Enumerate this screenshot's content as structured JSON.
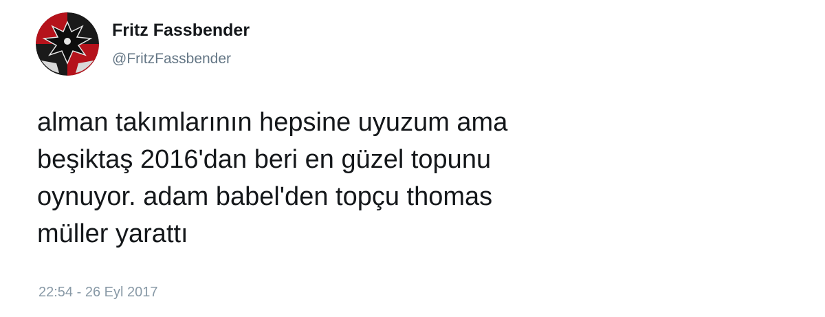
{
  "tweet": {
    "author": {
      "display_name": "Fritz Fassbender",
      "handle": "@FritzFassbender",
      "avatar_icon": "eagle-crest-icon"
    },
    "text": "alman takımlarının hepsine uyuzum ama\nbeşiktaş 2016'dan beri en güzel topunu\noynuyor. adam babel'den topçu thomas\nmüller yarattı",
    "timestamp": "22:54 - 26 Eyl 2017"
  },
  "colors": {
    "name": "#14171a",
    "handle": "#657786",
    "timestamp": "#8899a6",
    "avatar_red": "#b5121b",
    "avatar_dark": "#1a1a1a"
  }
}
